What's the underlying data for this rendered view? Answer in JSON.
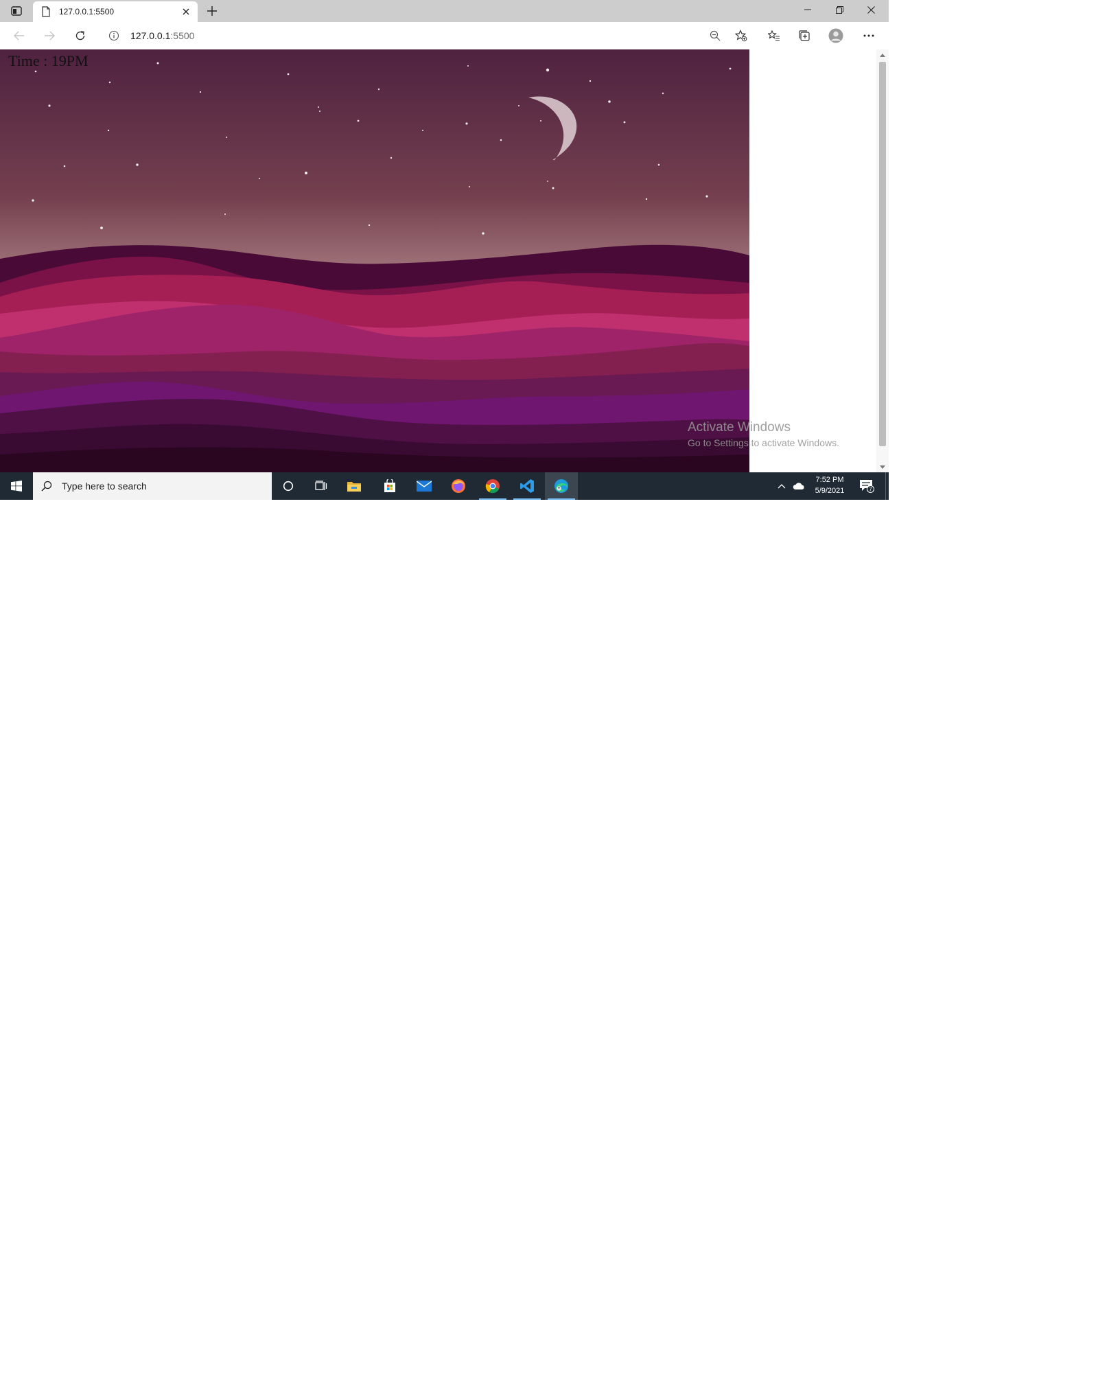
{
  "browser": {
    "tab": {
      "title": "127.0.0.1:5500"
    },
    "address": {
      "host": "127.0.0.1",
      "port": ":5500"
    }
  },
  "page": {
    "time_text": "Time : 19PM",
    "colors": {
      "sky_top": "#4f2240",
      "sky_bottom": "#b48a8c",
      "dune_dark": "#4a0a38",
      "dune_red": "#a51f55",
      "dune_pink": "#c0306f",
      "dune_purple": "#6e1670",
      "dune_deep": "#2a0620"
    }
  },
  "watermark": {
    "title": "Activate Windows",
    "subtitle": "Go to Settings to activate Windows."
  },
  "taskbar": {
    "search_placeholder": "Type here to search",
    "apps": [
      {
        "name": "cortana-icon"
      },
      {
        "name": "task-view-icon"
      },
      {
        "name": "file-explorer-icon"
      },
      {
        "name": "microsoft-store-icon"
      },
      {
        "name": "mail-icon"
      },
      {
        "name": "firefox-icon"
      },
      {
        "name": "chrome-icon"
      },
      {
        "name": "vscode-icon"
      },
      {
        "name": "edge-icon"
      }
    ],
    "clock": {
      "time": "7:52 PM",
      "date": "5/9/2021"
    },
    "notification_count": "7",
    "accent": "#76b9ed"
  }
}
